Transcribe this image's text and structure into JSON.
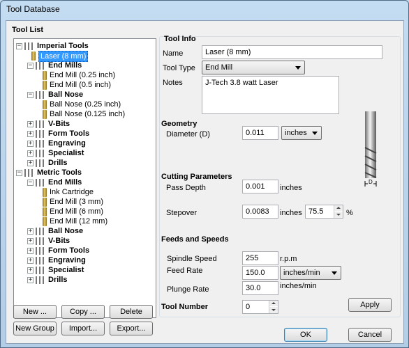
{
  "window": {
    "title": "Tool Database"
  },
  "tool_list": {
    "heading": "Tool List",
    "tree": [
      {
        "label": "Imperial Tools",
        "kind": "group",
        "expanded": true
      },
      {
        "label": "Laser (8 mm)",
        "kind": "tool",
        "selected": true
      },
      {
        "label": "End Mills",
        "kind": "group",
        "expanded": true
      },
      {
        "label": "End Mill (0.25 inch)",
        "kind": "tool"
      },
      {
        "label": "End Mill (0.5 inch)",
        "kind": "tool"
      },
      {
        "label": "Ball Nose",
        "kind": "group",
        "expanded": true
      },
      {
        "label": "Ball Nose (0.25 inch)",
        "kind": "tool"
      },
      {
        "label": "Ball Nose (0.125 inch)",
        "kind": "tool"
      },
      {
        "label": "V-Bits",
        "kind": "group",
        "expanded": false
      },
      {
        "label": "Form Tools",
        "kind": "group",
        "expanded": false
      },
      {
        "label": "Engraving",
        "kind": "group",
        "expanded": false
      },
      {
        "label": "Specialist",
        "kind": "group",
        "expanded": false
      },
      {
        "label": "Drills",
        "kind": "group",
        "expanded": false
      },
      {
        "label": "Metric Tools",
        "kind": "group",
        "expanded": true
      },
      {
        "label": "End Mills",
        "kind": "group",
        "expanded": true
      },
      {
        "label": "Ink Cartridge",
        "kind": "tool"
      },
      {
        "label": "End Mill (3 mm)",
        "kind": "tool"
      },
      {
        "label": "End Mill (6 mm)",
        "kind": "tool"
      },
      {
        "label": "End Mill (12 mm)",
        "kind": "tool"
      },
      {
        "label": "Ball Nose",
        "kind": "group",
        "expanded": false
      },
      {
        "label": "V-Bits",
        "kind": "group",
        "expanded": false
      },
      {
        "label": "Form Tools",
        "kind": "group",
        "expanded": false
      },
      {
        "label": "Engraving",
        "kind": "group",
        "expanded": false
      },
      {
        "label": "Specialist",
        "kind": "group",
        "expanded": false
      },
      {
        "label": "Drills",
        "kind": "group",
        "expanded": false
      }
    ],
    "buttons": {
      "new": "New ...",
      "copy": "Copy ...",
      "delete": "Delete",
      "new_group": "New Group",
      "import": "Import...",
      "export": "Export..."
    }
  },
  "tool_info": {
    "heading": "Tool Info",
    "name_label": "Name",
    "name_value": "Laser (8 mm)",
    "tool_type_label": "Tool Type",
    "tool_type_value": "End Mill",
    "notes_label": "Notes",
    "notes_value": "J-Tech 3.8 watt Laser"
  },
  "geometry": {
    "heading": "Geometry",
    "diameter_label": "Diameter (D)",
    "diameter_value": "0.011",
    "units_value": "inches",
    "diagram_label": "D"
  },
  "cutting": {
    "heading": "Cutting Parameters",
    "pass_depth_label": "Pass Depth",
    "pass_depth_value": "0.001",
    "pass_depth_unit": "inches",
    "stepover_label": "Stepover",
    "stepover_value": "0.0083",
    "stepover_unit": "inches",
    "stepover_percent": "75.5",
    "percent_sign": "%"
  },
  "feeds": {
    "heading": "Feeds and Speeds",
    "spindle_label": "Spindle Speed",
    "spindle_value": "255",
    "spindle_unit": "r.p.m",
    "feed_label": "Feed Rate",
    "feed_value": "150.0",
    "feed_unit": "inches/min",
    "plunge_label": "Plunge Rate",
    "plunge_value": "30.0",
    "plunge_unit": "inches/min"
  },
  "tool_number": {
    "label": "Tool Number",
    "value": "0"
  },
  "buttons": {
    "apply": "Apply",
    "ok": "OK",
    "cancel": "Cancel"
  },
  "colors": {
    "selection": "#3399ff",
    "accent_border": "#3c7fb1"
  }
}
